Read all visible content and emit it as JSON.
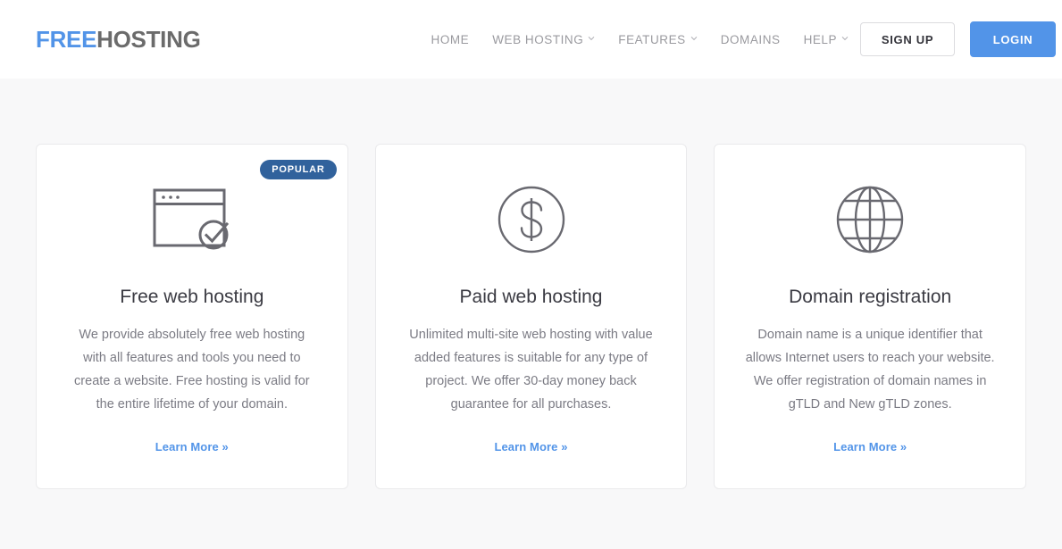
{
  "header": {
    "logo": {
      "part1": "FREE",
      "part2": "HOSTING"
    },
    "nav": [
      {
        "label": "HOME",
        "has_caret": false
      },
      {
        "label": "WEB HOSTING",
        "has_caret": true
      },
      {
        "label": "FEATURES",
        "has_caret": true
      },
      {
        "label": "DOMAINS",
        "has_caret": false
      },
      {
        "label": "HELP",
        "has_caret": true
      }
    ],
    "signup_label": "SIGN UP",
    "login_label": "LOGIN"
  },
  "colors": {
    "brand_blue": "#5294e8",
    "badge_blue": "#31629c",
    "logo_gray": "#6b6b6b",
    "page_bg": "#f8f8f9",
    "icon_gray": "#696970"
  },
  "cards": [
    {
      "badge": "POPULAR",
      "icon": "browser-check-icon",
      "title": "Free web hosting",
      "text": "We provide absolutely free web hosting with all features and tools you need to create a website. Free hosting is valid for the entire lifetime of your domain.",
      "link": "Learn More »"
    },
    {
      "badge": "",
      "icon": "dollar-circle-icon",
      "title": "Paid web hosting",
      "text": "Unlimited multi-site web hosting with value added features is suitable for any type of project. We offer 30-day money back guarantee for all purchases.",
      "link": "Learn More »"
    },
    {
      "badge": "",
      "icon": "globe-icon",
      "title": "Domain registration",
      "text": "Domain name is a unique identifier that allows Internet users to reach your website. We offer registration of domain names in gTLD and New gTLD zones.",
      "link": "Learn More »"
    }
  ]
}
